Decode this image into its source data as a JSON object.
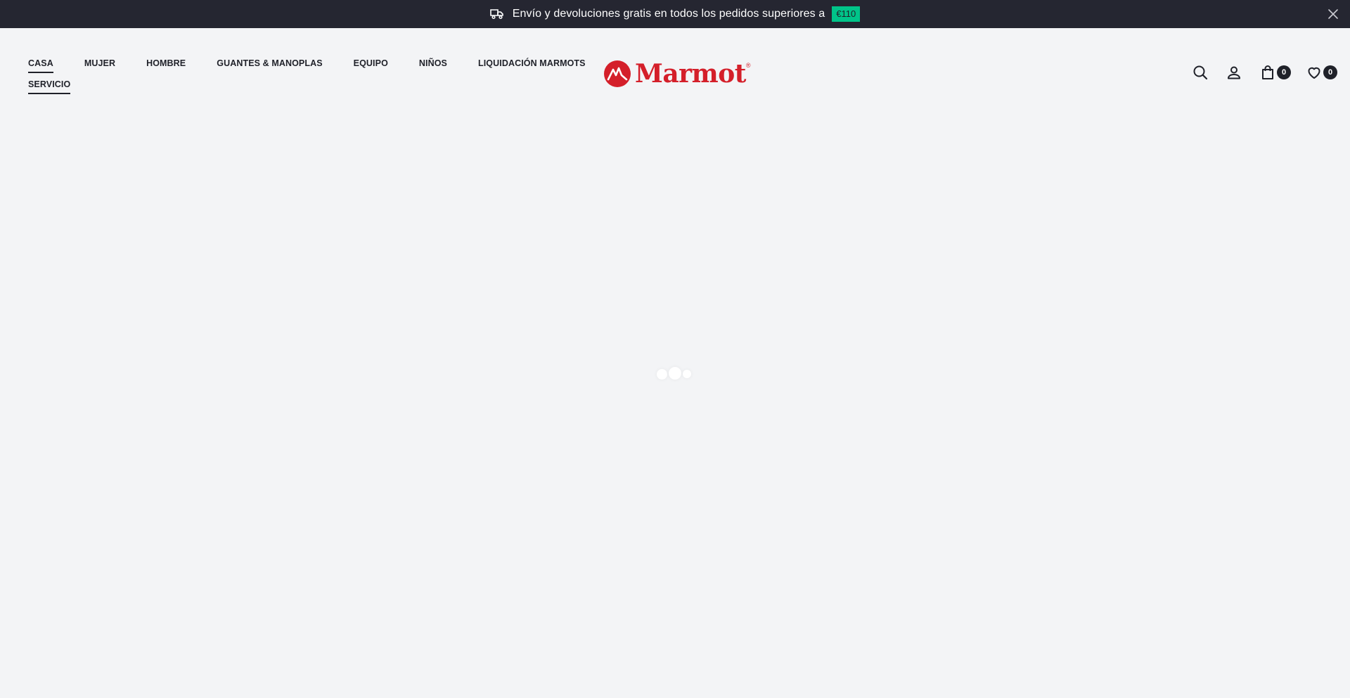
{
  "announcement": {
    "icon": "truck-icon",
    "text": "Envío y devoluciones gratis en todos los pedidos superiores a",
    "badge": "€110",
    "badge_color": "#00c489",
    "background": "#252631",
    "close_icon": "close-icon"
  },
  "nav": {
    "row1": [
      "CASA",
      "MUJER",
      "HOMBRE",
      "GUANTES & MANOPLAS",
      "EQUIPO",
      "NIÑOS",
      "LIQUIDACIÓN MARMOTS"
    ],
    "row2": [
      "SERVICIO"
    ]
  },
  "logo": {
    "text": "Marmot",
    "brand_color": "#d41f2a"
  },
  "header_icons": {
    "search": "search-icon",
    "account": "user-icon",
    "cart": "shopping-bag-icon",
    "cart_count": "0",
    "wishlist": "heart-icon",
    "wishlist_count": "0"
  },
  "loader": {
    "icon": "loading-dots"
  }
}
